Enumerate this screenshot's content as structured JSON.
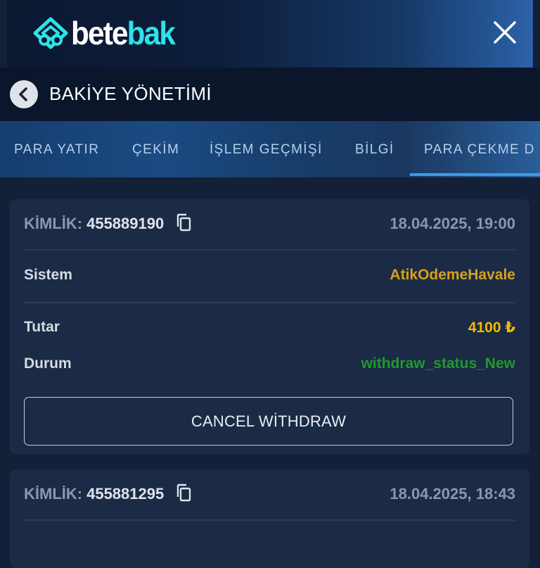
{
  "header": {
    "logo_part1": "bete",
    "logo_part2": "bak",
    "logo_icon": "gem-icon",
    "close_icon": "close-icon",
    "colors": {
      "accent": "#2ee2e8",
      "gold": "#f5b800",
      "green": "#1f9a2c",
      "system": "#d4a21a"
    }
  },
  "title": {
    "back_icon": "chevron-left-icon",
    "text": "BAKİYE YÖNETİMİ"
  },
  "tabs": [
    {
      "label": "PARA YATIR"
    },
    {
      "label": "ÇEKİM"
    },
    {
      "label": "İŞLEM GEÇMİŞİ"
    },
    {
      "label": "BİLGİ"
    },
    {
      "label": "PARA ÇEKME D"
    }
  ],
  "active_tab_index": 4,
  "transactions": [
    {
      "id_label": "KİMLİK:",
      "id": "455889190",
      "date": "18.04.2025, 19:00",
      "system_label": "Sistem",
      "system": "AtikOdemeHavale",
      "amount_label": "Tutar",
      "amount": "4100 ₺",
      "status_label": "Durum",
      "status": "withdraw_status_New",
      "cancel_label": "CANCEL WİTHDRAW"
    },
    {
      "id_label": "KİMLİK:",
      "id": "455881295",
      "date": "18.04.2025, 18:43"
    }
  ]
}
